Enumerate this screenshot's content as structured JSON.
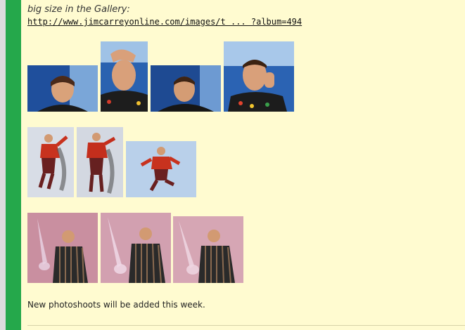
{
  "post": {
    "caption": "big size in the Gallery:",
    "link_text": "http://www.jimcarreyonline.com/images/t ... ?album=494",
    "note": "New photoshoots will be added this week."
  },
  "galleries": [
    {
      "row": 1,
      "photos": [
        "thumb-blue-1",
        "thumb-blue-2",
        "thumb-blue-3",
        "thumb-blue-4"
      ]
    },
    {
      "row": 2,
      "photos": [
        "thumb-jump-1",
        "thumb-jump-2",
        "thumb-jump-3"
      ]
    },
    {
      "row": 3,
      "photos": [
        "thumb-sword-1",
        "thumb-sword-2",
        "thumb-sword-3"
      ]
    }
  ],
  "colors": {
    "background": "#fffbd0",
    "side_bar": "#25a84b"
  }
}
